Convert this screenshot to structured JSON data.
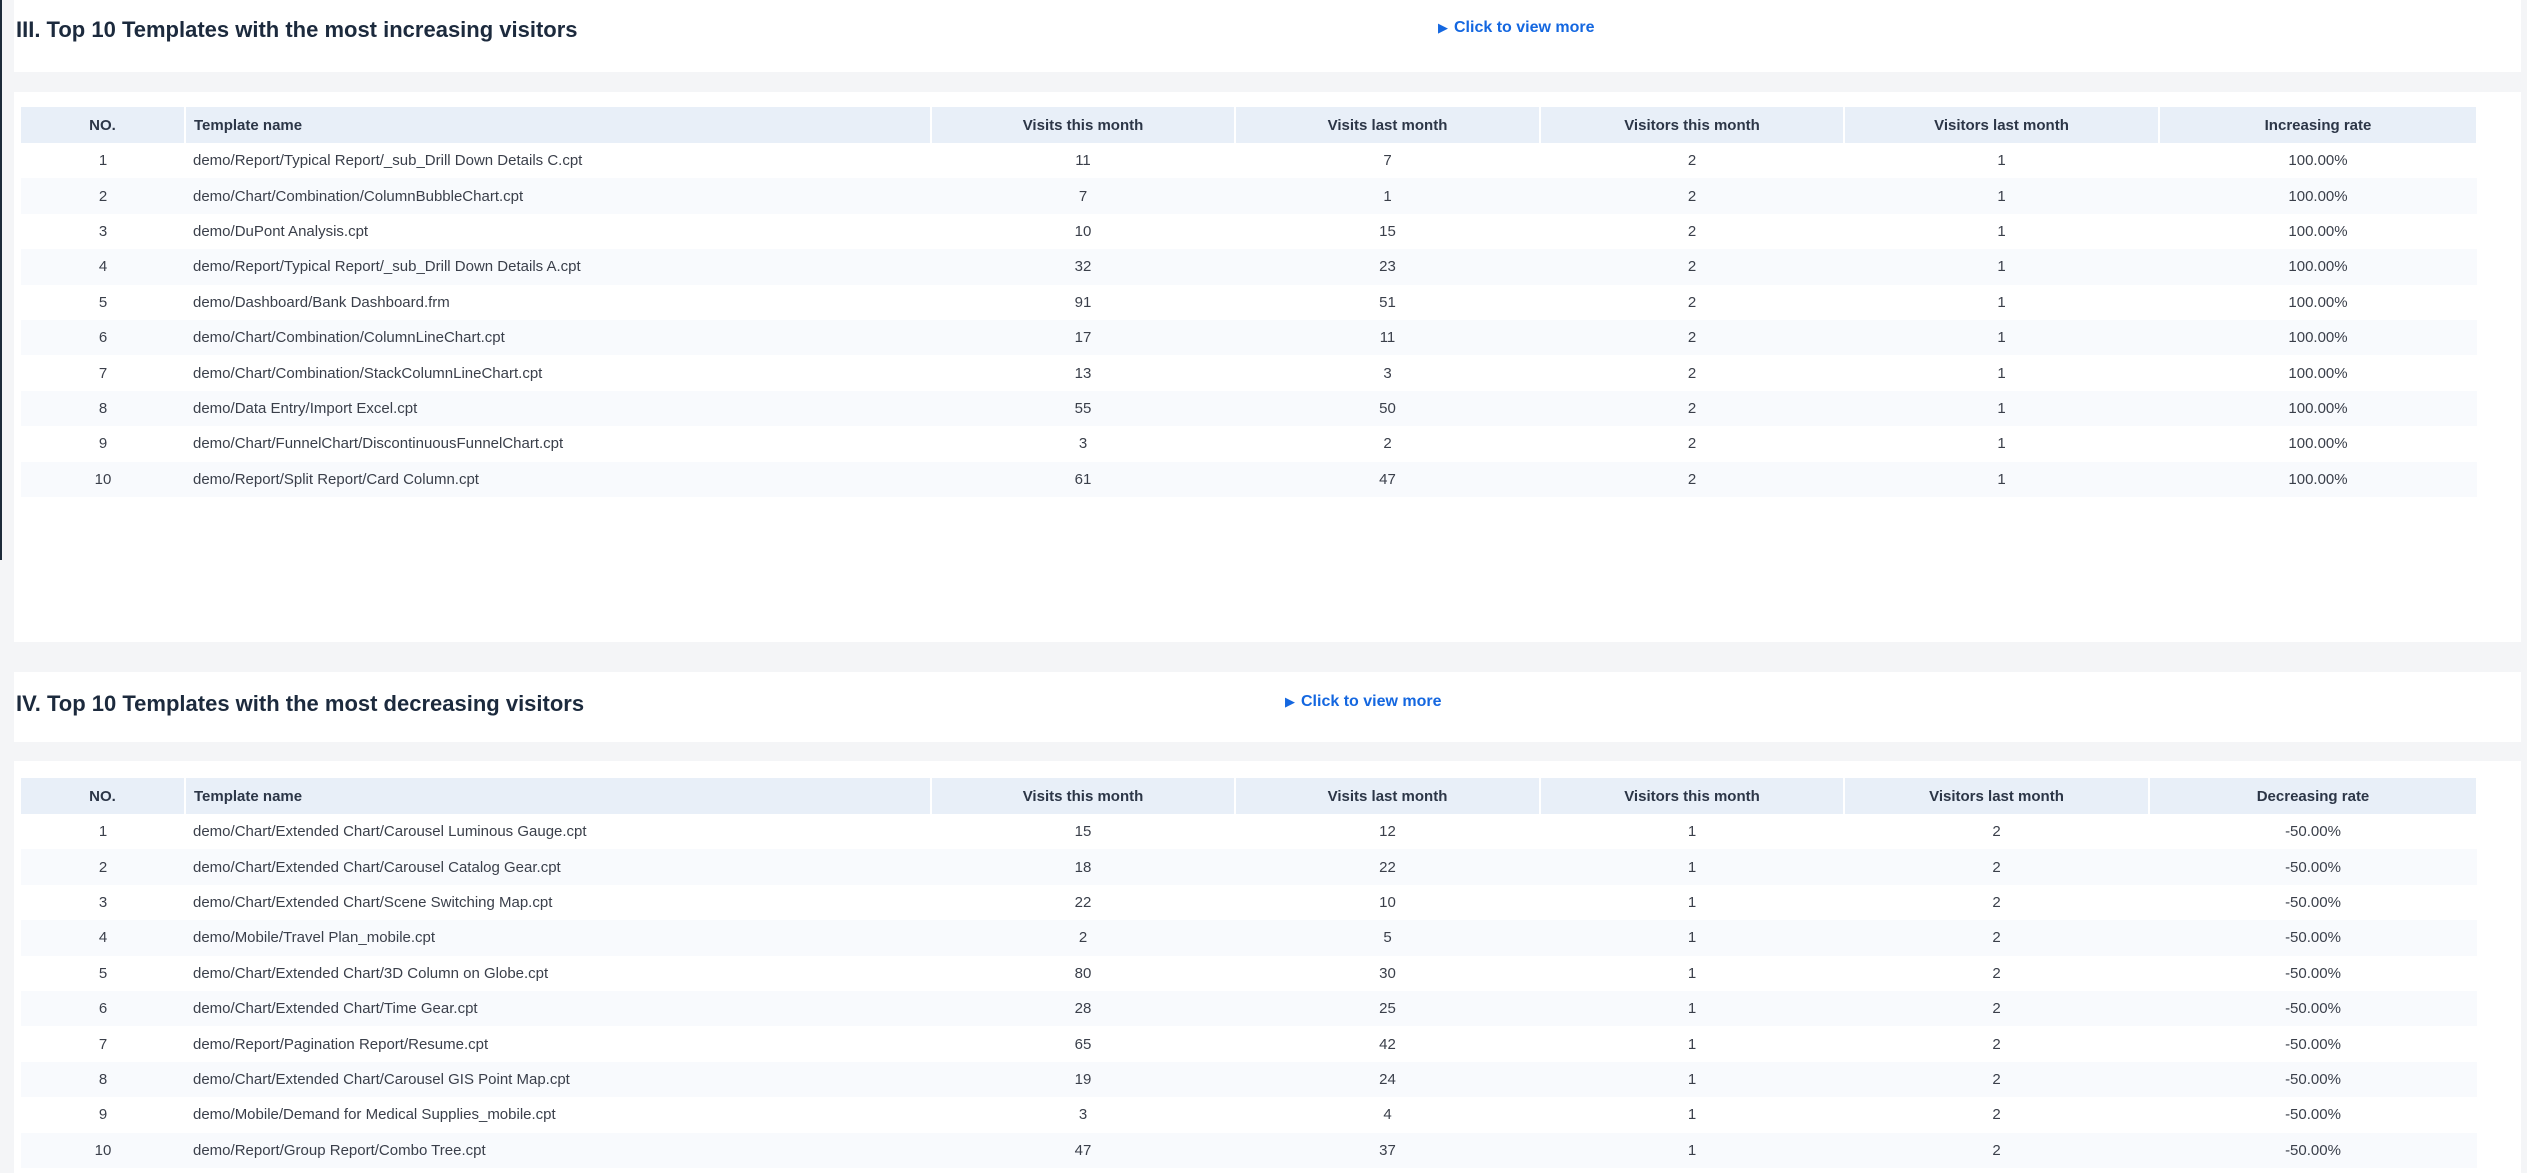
{
  "increasing": {
    "title": "III. Top 10 Templates with the most increasing visitors",
    "more_link": "Click to view more",
    "columns": [
      "NO.",
      "Template name",
      "Visits this month",
      "Visits last month",
      "Visitors this month",
      "Visitors last month",
      "Increasing rate"
    ],
    "rows": [
      [
        "1",
        "demo/Report/Typical Report/_sub_Drill Down Details C.cpt",
        "11",
        "7",
        "2",
        "1",
        "100.00%"
      ],
      [
        "2",
        "demo/Chart/Combination/ColumnBubbleChart.cpt",
        "7",
        "1",
        "2",
        "1",
        "100.00%"
      ],
      [
        "3",
        "demo/DuPont Analysis.cpt",
        "10",
        "15",
        "2",
        "1",
        "100.00%"
      ],
      [
        "4",
        "demo/Report/Typical Report/_sub_Drill Down Details A.cpt",
        "32",
        "23",
        "2",
        "1",
        "100.00%"
      ],
      [
        "5",
        "demo/Dashboard/Bank Dashboard.frm",
        "91",
        "51",
        "2",
        "1",
        "100.00%"
      ],
      [
        "6",
        "demo/Chart/Combination/ColumnLineChart.cpt",
        "17",
        "11",
        "2",
        "1",
        "100.00%"
      ],
      [
        "7",
        "demo/Chart/Combination/StackColumnLineChart.cpt",
        "13",
        "3",
        "2",
        "1",
        "100.00%"
      ],
      [
        "8",
        "demo/Data Entry/Import Excel.cpt",
        "55",
        "50",
        "2",
        "1",
        "100.00%"
      ],
      [
        "9",
        "demo/Chart/FunnelChart/DiscontinuousFunnelChart.cpt",
        "3",
        "2",
        "2",
        "1",
        "100.00%"
      ],
      [
        "10",
        "demo/Report/Split Report/Card Column.cpt",
        "61",
        "47",
        "2",
        "1",
        "100.00%"
      ]
    ]
  },
  "decreasing": {
    "title": "IV. Top 10 Templates with the most decreasing visitors",
    "more_link": "Click to view more",
    "columns": [
      "NO.",
      "Template name",
      "Visits this month",
      "Visits last month",
      "Visitors this month",
      "Visitors last month",
      "Decreasing rate"
    ],
    "rows": [
      [
        "1",
        "demo/Chart/Extended Chart/Carousel Luminous Gauge.cpt",
        "15",
        "12",
        "1",
        "2",
        "-50.00%"
      ],
      [
        "2",
        "demo/Chart/Extended Chart/Carousel Catalog Gear.cpt",
        "18",
        "22",
        "1",
        "2",
        "-50.00%"
      ],
      [
        "3",
        "demo/Chart/Extended Chart/Scene Switching Map.cpt",
        "22",
        "10",
        "1",
        "2",
        "-50.00%"
      ],
      [
        "4",
        "demo/Mobile/Travel Plan_mobile.cpt",
        "2",
        "5",
        "1",
        "2",
        "-50.00%"
      ],
      [
        "5",
        "demo/Chart/Extended Chart/3D Column on Globe.cpt",
        "80",
        "30",
        "1",
        "2",
        "-50.00%"
      ],
      [
        "6",
        "demo/Chart/Extended Chart/Time Gear.cpt",
        "28",
        "25",
        "1",
        "2",
        "-50.00%"
      ],
      [
        "7",
        "demo/Report/Pagination Report/Resume.cpt",
        "65",
        "42",
        "1",
        "2",
        "-50.00%"
      ],
      [
        "8",
        "demo/Chart/Extended Chart/Carousel GIS Point Map.cpt",
        "19",
        "24",
        "1",
        "2",
        "-50.00%"
      ],
      [
        "9",
        "demo/Mobile/Demand for Medical Supplies_mobile.cpt",
        "3",
        "4",
        "1",
        "2",
        "-50.00%"
      ],
      [
        "10",
        "demo/Report/Group Report/Combo Tree.cpt",
        "47",
        "37",
        "1",
        "2",
        "-50.00%"
      ]
    ]
  },
  "colors": {
    "link": "#1467e0",
    "header_bg": "#e8eff8",
    "page_bg": "#f4f5f7"
  },
  "icons": {
    "more_link": "play-triangle-icon"
  }
}
